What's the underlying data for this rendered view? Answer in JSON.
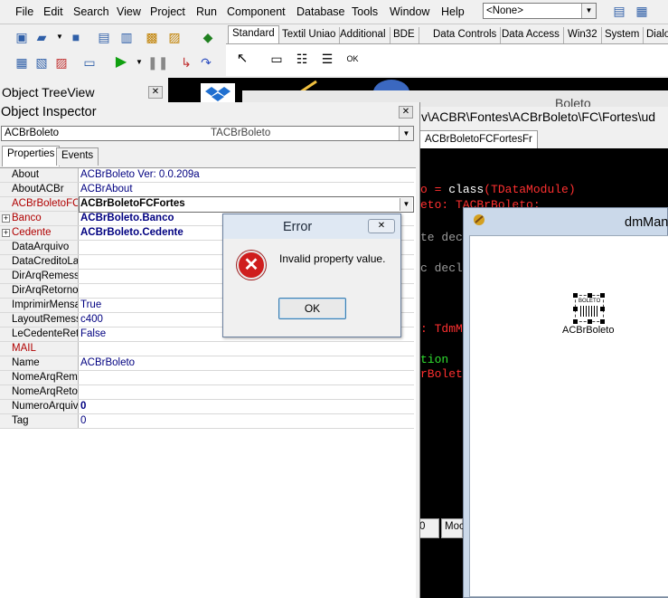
{
  "menu": {
    "items": [
      "File",
      "Edit",
      "Search",
      "View",
      "Project",
      "Run",
      "Component",
      "Database",
      "Tools",
      "Window",
      "Help"
    ],
    "desktop_combo": "<None>"
  },
  "palette": {
    "tabs": [
      "Standard",
      "Textil Uniao",
      "Additional",
      "BDE",
      "Data Controls",
      "Data Access",
      "Win32",
      "System",
      "Dialo"
    ]
  },
  "tree_view": {
    "title": "Object TreeView"
  },
  "editor": {
    "caption_fragment": "Boleto",
    "path": "v\\ACBR\\Fontes\\ACBrBoleto\\FC\\Fortes\\ud",
    "unit_tab": "ACBrBoletoFCFortesFr",
    "code_lines": [
      {
        "text": "o = class(TDataModule)",
        "parts": [
          {
            "t": "o = ",
            "c": "#ff3030"
          },
          {
            "t": "class",
            "c": "#ffffff"
          },
          {
            "t": "(",
            "c": "#ff3030"
          },
          {
            "t": "TDataModule",
            "c": "#ff3030"
          },
          {
            "t": ")",
            "c": "#ff3030"
          }
        ]
      },
      {
        "text": "eto: TACBrBoleto;",
        "parts": [
          {
            "t": "eto: TACBrBoleto;",
            "c": "#ff3030"
          }
        ]
      },
      {
        "text": "te dec",
        "parts": [
          {
            "t": "te dec",
            "c": "#9a9a9a"
          }
        ]
      },
      {
        "text": "c decl",
        "parts": [
          {
            "t": "c decl",
            "c": "#9a9a9a"
          }
        ]
      },
      {
        "text": ": TdmM",
        "parts": [
          {
            "t": ": TdmM",
            "c": "#ff3030"
          }
        ]
      },
      {
        "text": "tion",
        "parts": [
          {
            "t": "tion",
            "c": "#30e030"
          }
        ]
      },
      {
        "text": "rBolet",
        "parts": [
          {
            "t": "rBolet",
            "c": "#ff3030"
          }
        ]
      }
    ],
    "status_line": "0",
    "status_mode": "Moc"
  },
  "dm_window": {
    "title": "dmMan",
    "component_label": "ACBrBoleto",
    "component_icon_text": "BOLETO"
  },
  "inspector": {
    "title": "Object Inspector",
    "object_combo": {
      "name": "ACBrBoleto",
      "type": "TACBrBoleto"
    },
    "tabs": [
      "Properties",
      "Events"
    ],
    "properties": [
      {
        "name": "About",
        "value": "ACBrBoleto Ver: 0.0.209a",
        "style": "normal"
      },
      {
        "name": "AboutACBr",
        "value": "ACBrAbout",
        "style": "normal"
      },
      {
        "name": "ACBrBoletoFC",
        "value": "ACBrBoletoFCFortes",
        "style": "selected-red"
      },
      {
        "name": "Banco",
        "value": "ACBrBoleto.Banco",
        "style": "expand-red"
      },
      {
        "name": "Cedente",
        "value": "ACBrBoleto.Cedente",
        "style": "expand-red"
      },
      {
        "name": "DataArquivo",
        "value": "",
        "style": "normal"
      },
      {
        "name": "DataCreditoLan",
        "value": "",
        "style": "normal"
      },
      {
        "name": "DirArqRemessa",
        "value": "",
        "style": "normal"
      },
      {
        "name": "DirArqRetorno",
        "value": "",
        "style": "normal"
      },
      {
        "name": "ImprimirMensag",
        "value": "True",
        "style": "normal"
      },
      {
        "name": "LayoutRemessa",
        "value": "c400",
        "style": "normal"
      },
      {
        "name": "LeCedenteReto",
        "value": "False",
        "style": "normal"
      },
      {
        "name": "MAIL",
        "value": "",
        "style": "red"
      },
      {
        "name": "Name",
        "value": "ACBrBoleto",
        "style": "normal"
      },
      {
        "name": "NomeArqReme",
        "value": "",
        "style": "normal"
      },
      {
        "name": "NomeArqRetor",
        "value": "",
        "style": "normal"
      },
      {
        "name": "NumeroArquivo",
        "value": "0",
        "style": "boldval"
      },
      {
        "name": "Tag",
        "value": "0",
        "style": "normal"
      }
    ]
  },
  "dialog": {
    "title": "Error",
    "message": "Invalid property value.",
    "ok_label": "OK",
    "icon": "error-icon"
  },
  "colors": {
    "editor_bg": "#000000",
    "value_text": "#000080",
    "error_red": "#cf1d1d"
  }
}
